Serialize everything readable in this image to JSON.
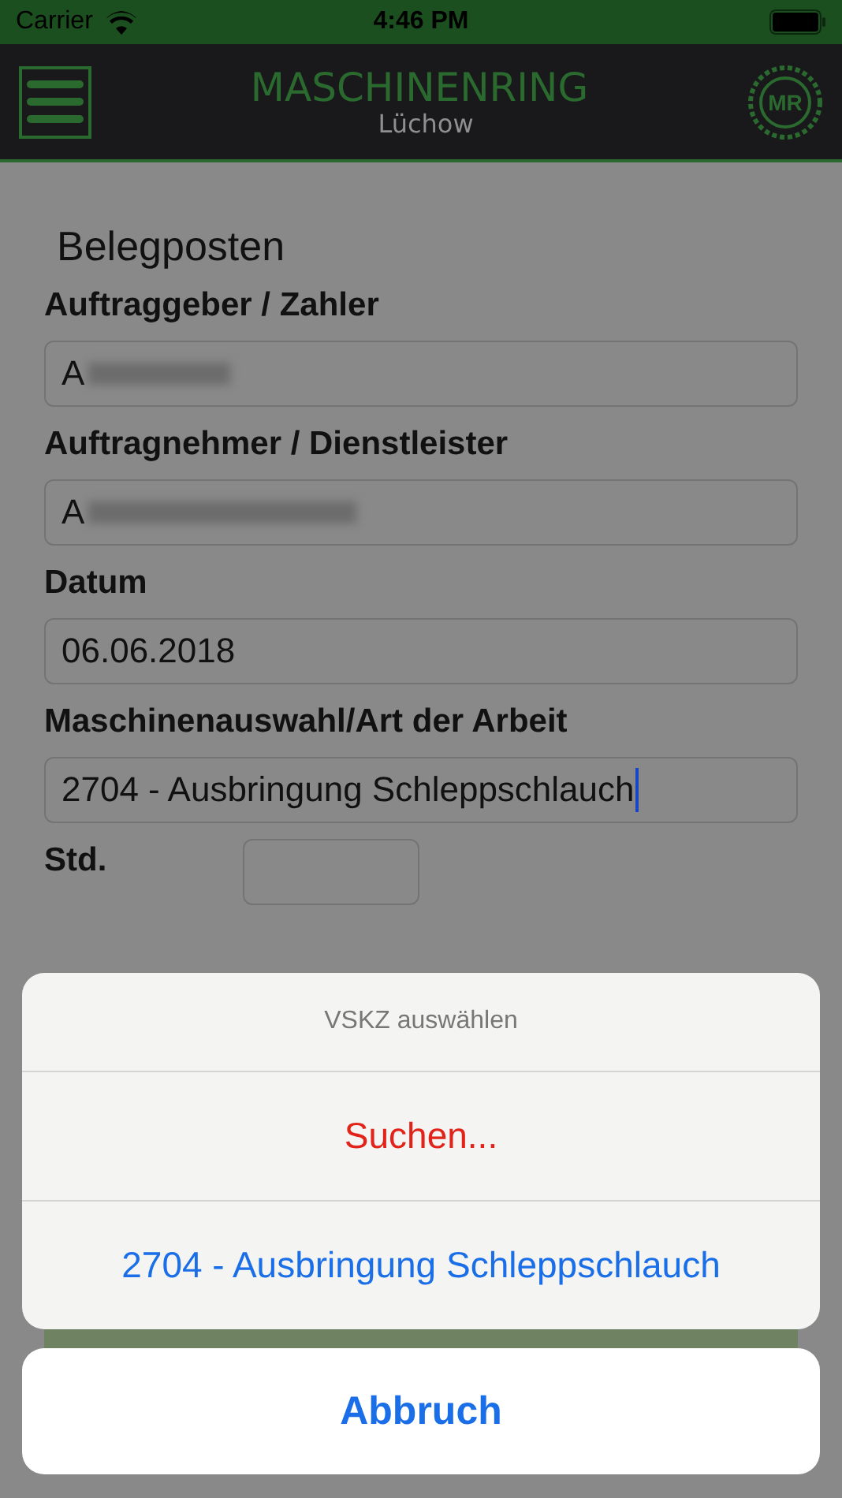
{
  "status_bar": {
    "carrier": "Carrier",
    "time": "4:46 PM"
  },
  "header": {
    "title": "MASCHINENRING",
    "subtitle": "Lüchow",
    "logo": "MR"
  },
  "form": {
    "title": "Belegposten",
    "fields": [
      {
        "label": "Auftraggeber / Zahler",
        "value": "A",
        "blurred": true,
        "focused": false
      },
      {
        "label": "Auftragnehmer / Dienstleister",
        "value": "A",
        "blurred": true,
        "focused": false
      },
      {
        "label": "Datum",
        "value": "06.06.2018",
        "blurred": false,
        "focused": false
      },
      {
        "label": "Maschinenauswahl/Art der Arbeit",
        "value": "2704 - Ausbringung Schleppschlauch",
        "blurred": false,
        "focused": true
      }
    ],
    "hours": {
      "label": "Std."
    }
  },
  "action_sheet": {
    "title": "VSKZ auswählen",
    "actions": [
      {
        "label": "Suchen...",
        "kind": "destructive"
      },
      {
        "label": "2704 - Ausbringung Schleppschlauch",
        "kind": "default"
      }
    ],
    "cancel": "Abbruch"
  }
}
